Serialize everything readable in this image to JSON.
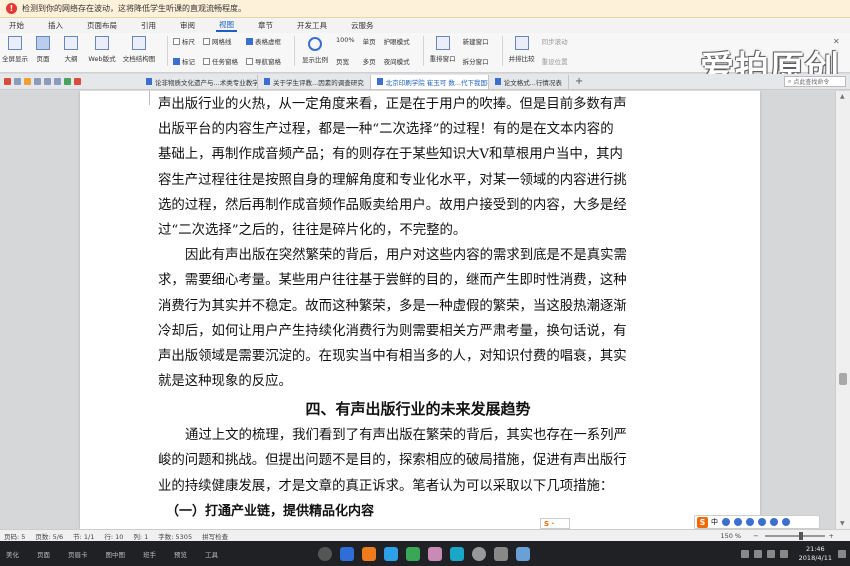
{
  "warning": {
    "icon": "warning-icon",
    "text": "检测到你的网络存在波动，这将降低学生听课的直观流畅程度。"
  },
  "watermark": "爱拍原创",
  "ribbon_tabs": [
    "开始",
    "插入",
    "页面布局",
    "引用",
    "审阅",
    "视图",
    "章节",
    "开发工具",
    "云服务"
  ],
  "active_tab": "视图",
  "ribbon": {
    "views": [
      {
        "label": "全屏显示",
        "selected": false
      },
      {
        "label": "页面",
        "selected": true
      },
      {
        "label": "大纲",
        "selected": false
      },
      {
        "label": "Web版式",
        "selected": false
      }
    ],
    "doc_structure": "文档结构图",
    "checks_col1": [
      "标尺",
      "标记"
    ],
    "checks_col2": [
      "网格线",
      "任务窗格"
    ],
    "checks_col3": [
      "表格虚框",
      "导航窗格"
    ],
    "zoom_label": "显示比例",
    "zoom_items": [
      "100%",
      "单页",
      "页宽",
      "多页"
    ],
    "eye_items": [
      "护眼模式",
      "夜间模式"
    ],
    "window_items": [
      "重排窗口",
      "新建窗口",
      "拆分窗口"
    ],
    "side_items": [
      "并排比较",
      "同步滚动",
      "重设位置"
    ]
  },
  "doctabs": [
    {
      "label": "论非物质文化遗产与...术类专业教学的融合",
      "active": false
    },
    {
      "label": "关于学生评教...因素的调查研究",
      "active": false
    },
    {
      "label": "北京印刷学院 崔玉可 数...代下我国有声出版行业研究",
      "active": true
    },
    {
      "label": "论文格式...行情况表",
      "active": false
    }
  ],
  "search_placeholder": "点此查找命令",
  "document": {
    "para1": [
      "声出版行业的火热，从一定角度来看，正是在于用户的吹捧。但是目前多数有声",
      "出版平台的内容生产过程，都是一种“二次选择”的过程！有的是在文本内容的",
      "基础上，再制作成音频产品；有的则存在于某些知识大Ⅴ和草根用户当中，其内",
      "容生产过程往往是按照自身的理解角度和专业化水平，对某一领域的内容进行挑",
      "选的过程，然后再制作成音频作品贩卖给用户。故用户接受到的内容，大多是经",
      "过“二次选择”之后的，往往是碎片化的，不完整的。"
    ],
    "para2": [
      "因此有声出版在突然繁荣的背后，用户对这些内容的需求到底是不是真实需",
      "求，需要细心考量。某些用户往往基于尝鲜的目的，继而产生即时性消费，这种",
      "消费行为其实并不稳定。故而这种繁荣，多是一种虚假的繁荣，当这股热潮逐渐",
      "冷却后，如何让用户产生持续化消费行为则需要相关方严肃考量，换句话说，有",
      "声出版领域是需要沉淀的。在现实当中有相当多的人，对知识付费的唱衰，其实",
      "就是这种现象的反应。"
    ],
    "heading": "四、有声出版行业的未来发展趋势",
    "para3": [
      "通过上文的梳理，我们看到了有声出版在繁荣的背后，其实也存在一系列严",
      "峻的问题和挑战。但提出问题不是目的，探索相应的破局措施，促进有声出版行",
      "业的持续健康发展，才是文章的真正诉求。笔者认为可以采取以下几项措施："
    ],
    "subheading": "（一）打通产业链，提供精品化内容"
  },
  "status": {
    "page": "页码: 5",
    "pages": "页数: 5/6",
    "section": "节: 1/1",
    "row": "行: 10",
    "col": "列: 1",
    "words": "字数: 5305",
    "spell": "拼写检查",
    "zoom": "150 %"
  },
  "taskbar": {
    "labels": [
      "美化",
      "页面",
      "页眉卡",
      "图中图",
      "班手",
      "预览",
      "工具"
    ],
    "time": "21:46",
    "date": "2018/4/11"
  }
}
